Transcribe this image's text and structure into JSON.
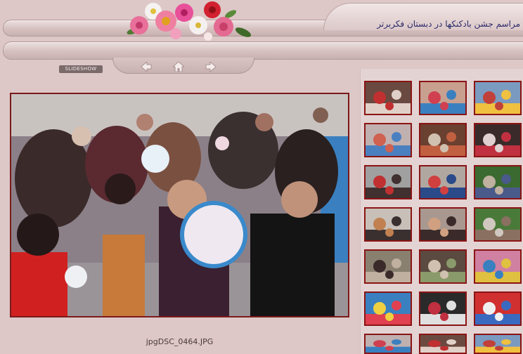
{
  "header": {
    "album_title": "مراسم جشن بادکنکها در دبستان فکربرتر"
  },
  "navigation": {
    "slideshow_label": "SLIDESHOW",
    "previous_icon": "arrow-left-icon",
    "home_icon": "home-icon",
    "next_icon": "arrow-right-icon"
  },
  "main_photo": {
    "caption": "jpgDSC_0464.JPG"
  },
  "thumbnails": {
    "rows": 7,
    "columns": 3,
    "visible_count": 21
  },
  "colors": {
    "background": "#ddc7c7",
    "frame_border": "#8a1414",
    "title_text": "#2a2a6a"
  }
}
